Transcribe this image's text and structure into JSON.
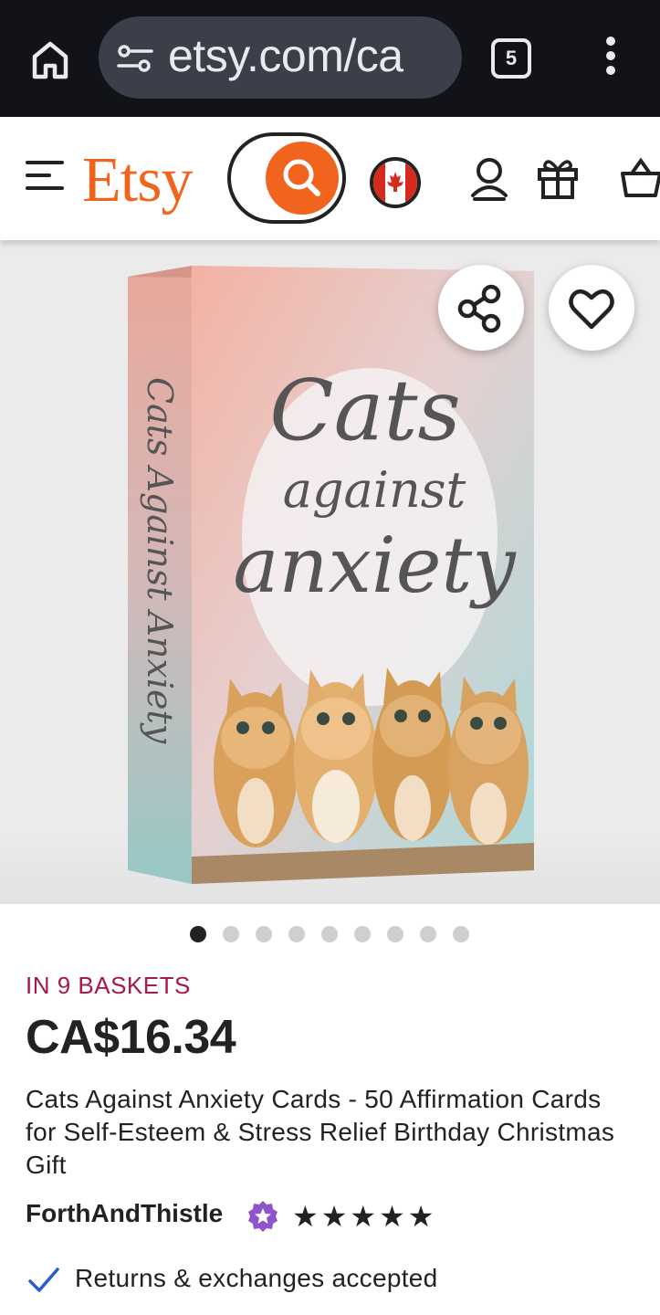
{
  "browser": {
    "url": "etsy.com/ca",
    "tab_count": "5"
  },
  "header": {
    "logo": "Etsy",
    "colors": {
      "brand": "#f1641e",
      "basket_text": "#a61a4a"
    }
  },
  "product": {
    "image": {
      "box_title_line1": "Cats",
      "box_title_line2": "against",
      "box_title_line3": "anxiety",
      "spine_text": "Cats Against Anxiety",
      "page_count": 9,
      "active_page": 0
    },
    "baskets": "IN 9 BASKETS",
    "price": "CA$16.34",
    "title": "Cats Against Anxiety Cards - 50 Affirmation Cards for Self-Esteem & Stress Relief Birthday Christmas Gift",
    "shop_name": "ForthAndThistle",
    "rating": 5,
    "stars": [
      "★",
      "★",
      "★",
      "★",
      "★"
    ],
    "returns": "Returns & exchanges accepted"
  }
}
